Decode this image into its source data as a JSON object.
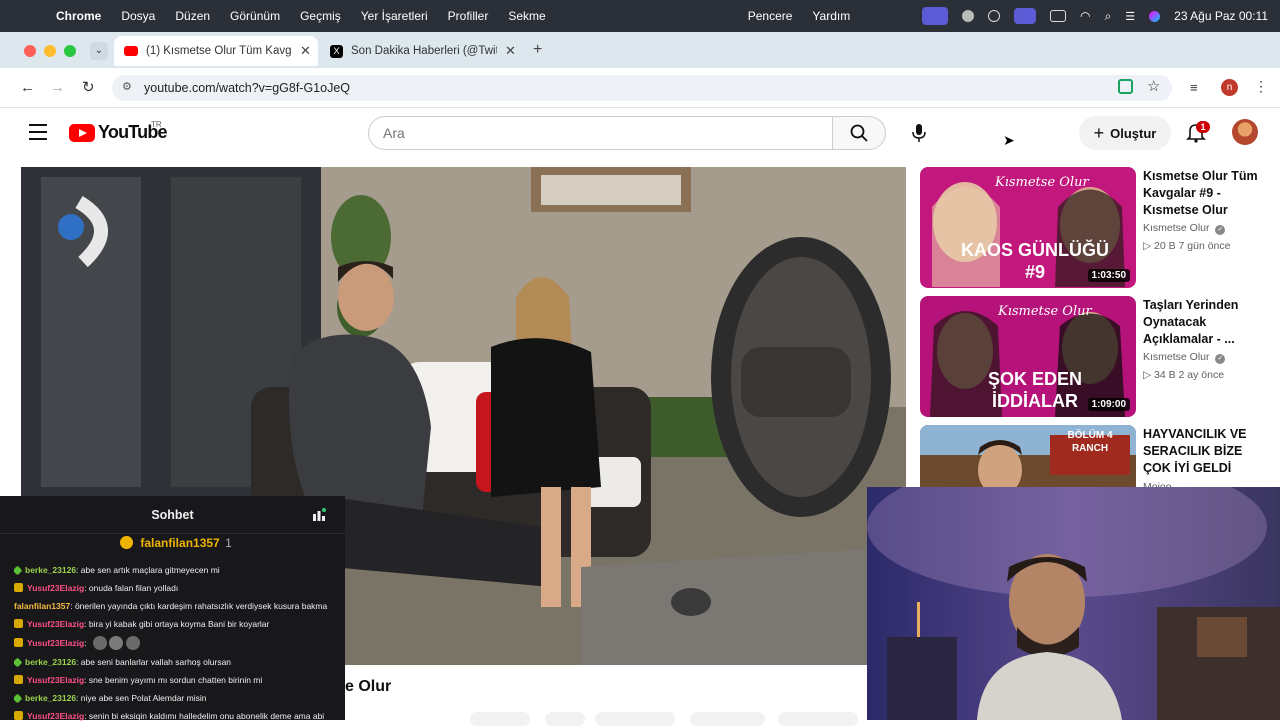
{
  "menubar": {
    "app": "Chrome",
    "items": [
      "Dosya",
      "Düzen",
      "Görünüm",
      "Geçmiş",
      "Yer İşaretleri",
      "Profiller",
      "Sekme"
    ],
    "right_items": [
      "Pencere",
      "Yardım"
    ],
    "datetime": "23 Ağu Paz  00:11"
  },
  "tabs": [
    {
      "title": "(1) Kısmetse Olur Tüm Kavgalı",
      "icon": "youtube-icon"
    },
    {
      "title": "Son Dakika Haberleri (@Twitte",
      "icon": "x-icon"
    }
  ],
  "address": {
    "url": "youtube.com/watch?v=gG8f-G1oJeQ"
  },
  "youtube": {
    "logo_text": "YouTube",
    "region": "TR",
    "search_placeholder": "Ara",
    "create_label": "Oluştur",
    "notif_count": "1"
  },
  "sidebar_videos": [
    {
      "title": "Kısmetse Olur Tüm Kavgalar #9 - Kısmetse Olur",
      "channel": "Kısmetse Olur",
      "meta": "▷ 20 B   7 gün önce",
      "duration": "1:03:50",
      "thumb_text": "KAOS GÜNLÜĞÜ #9",
      "brand": "Kısmetse Olur"
    },
    {
      "title": "Taşları Yerinden Oynatacak Açıklamalar - ...",
      "channel": "Kısmetse Olur",
      "meta": "▷ 34 B   2 ay önce",
      "duration": "1:09:00",
      "thumb_text": "ŞOK EDEN İDDİALAR",
      "brand": "Kısmetse Olur"
    },
    {
      "title": "HAYVANCILIK VE SERACILIK BİZE ÇOK İYİ GELDİ ÇİFTLİK ...",
      "channel": "Mojoo",
      "meta": "",
      "duration": "",
      "thumb_text": "BÖLÜM 4 RANCH",
      "brand": ""
    }
  ],
  "chat": {
    "title": "Sohbet",
    "pinned_user": "falanfilan1357",
    "pinned_count": "1",
    "messages": [
      {
        "user": "berke_23126",
        "text": ": abe sen artık maçlara gitmeyecen mi",
        "color": "#9ad34a",
        "badge": "#5bc236"
      },
      {
        "user": "Yusuf23Elazig",
        "text": ": onuda falan filan yolladı",
        "color": "#ff4f8b",
        "badge": "#d8a900"
      },
      {
        "user": "falanfilan1357",
        "text": ": önerilen yayında çıktı kardeşim rahatsızlık verdiysek kusura bakma",
        "color": "#f5b942",
        "badge": ""
      },
      {
        "user": "Yusuf23Elazig",
        "text": ": bira yi kabak gibi ortaya koyma Bani bir koyarlar",
        "color": "#ff4f8b",
        "badge": "#d8a900"
      },
      {
        "user": "Yusuf23Elazig",
        "text": ":",
        "color": "#ff4f8b",
        "badge": "#d8a900"
      },
      {
        "user": "berke_23126",
        "text": ": abe seni banlarlar vallah sarhoş olursan",
        "color": "#9ad34a",
        "badge": "#5bc236"
      },
      {
        "user": "Yusuf23Elazig",
        "text": ": sne benim yayımı mı sordun chatten birinin mi",
        "color": "#ff4f8b",
        "badge": "#d8a900"
      },
      {
        "user": "berke_23126",
        "text": ": niye abe sen Polat Alemdar misin",
        "color": "#9ad34a",
        "badge": "#5bc236"
      },
      {
        "user": "Yusuf23Elazig",
        "text": ": senin bi eksiqin kaldımı halledelim onu abonelik deme ama abi",
        "color": "#ff4f8b",
        "badge": "#d8a900"
      }
    ]
  },
  "video_title_partial": "e Olur"
}
